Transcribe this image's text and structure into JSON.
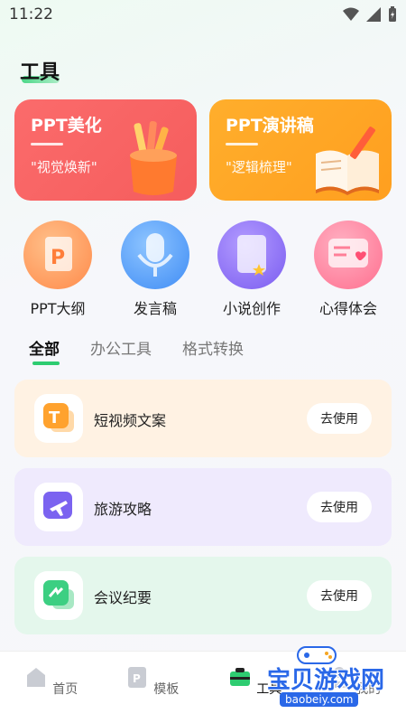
{
  "status": {
    "time": "11:22"
  },
  "header": {
    "title": "工具"
  },
  "feature_cards": [
    {
      "title": "PPT美化",
      "subtitle": "\"视觉焕新\""
    },
    {
      "title": "PPT演讲稿",
      "subtitle": "\"逻辑梳理\""
    }
  ],
  "quick_actions": [
    {
      "label": "PPT大纲",
      "icon": "ppt-doc-icon"
    },
    {
      "label": "发言稿",
      "icon": "microphone-icon"
    },
    {
      "label": "小说创作",
      "icon": "bookmark-star-icon"
    },
    {
      "label": "心得体会",
      "icon": "heart-message-icon"
    }
  ],
  "tabs": [
    {
      "label": "全部",
      "active": true
    },
    {
      "label": "办公工具",
      "active": false
    },
    {
      "label": "格式转换",
      "active": false
    }
  ],
  "tools": [
    {
      "name": "短视频文案",
      "button": "去使用",
      "icon": "letter-t-icon"
    },
    {
      "name": "旅游攻略",
      "button": "去使用",
      "icon": "airplane-icon"
    },
    {
      "name": "会议纪要",
      "button": "去使用",
      "icon": "meeting-notes-icon"
    }
  ],
  "bottom_nav": [
    {
      "label": "首页",
      "active": false
    },
    {
      "label": "模板",
      "active": false
    },
    {
      "label": "工具",
      "active": true
    },
    {
      "label": "我的",
      "active": false
    }
  ],
  "watermark": {
    "text": "宝贝游戏网",
    "url": "baobeiy.com"
  },
  "colors": {
    "accent_green": "#2ecc71",
    "card_red": "#f55d5d",
    "card_orange": "#ff9f1f",
    "tool1_bg": "#fff2e3",
    "tool2_bg": "#efeafd",
    "tool3_bg": "#e4f7ec"
  }
}
